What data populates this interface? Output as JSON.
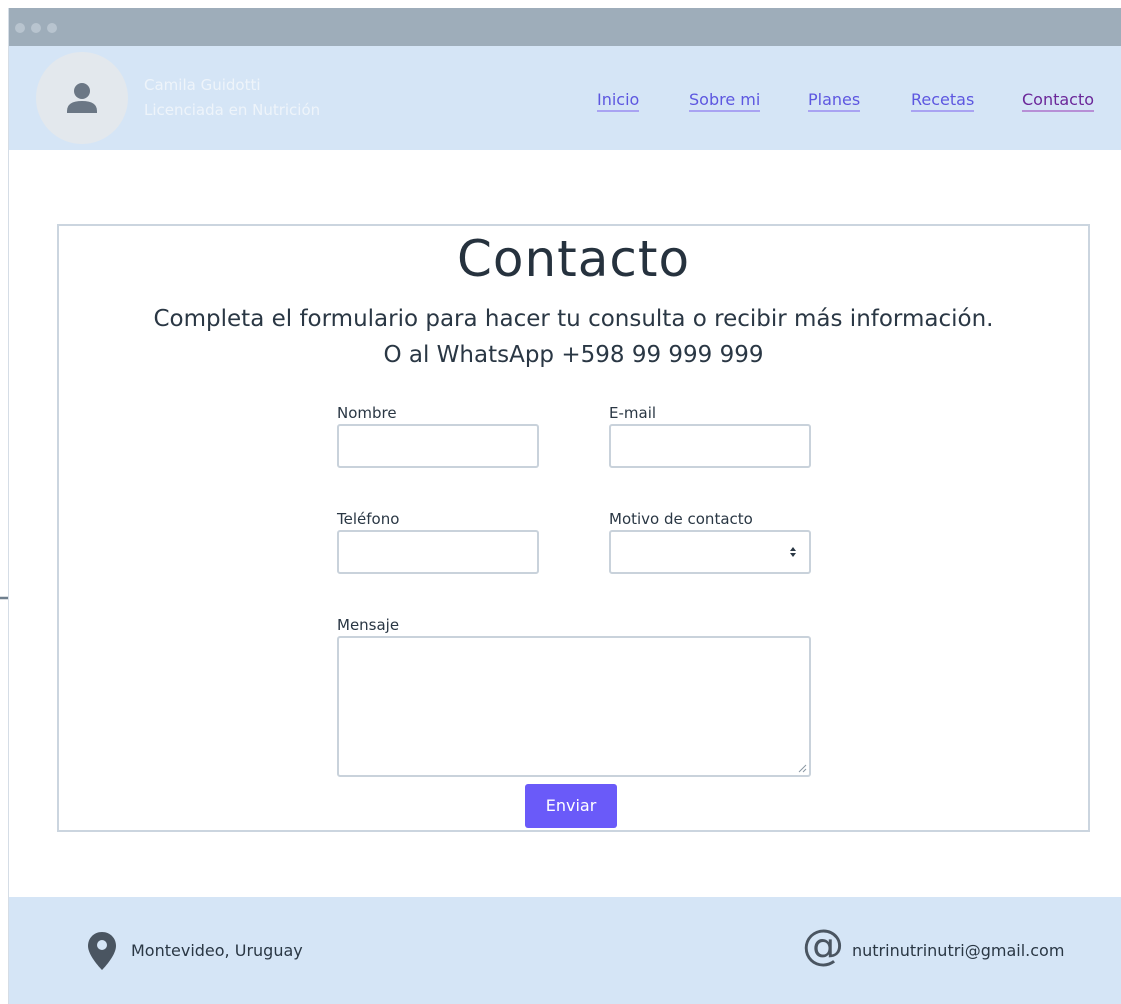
{
  "header": {
    "brand_name": "Camila Guidotti",
    "brand_title": "Licenciada en Nutrición",
    "nav": [
      {
        "label": "Inicio"
      },
      {
        "label": "Sobre mi"
      },
      {
        "label": "Planes"
      },
      {
        "label": "Recetas"
      },
      {
        "label": "Contacto",
        "active": true
      }
    ]
  },
  "contact": {
    "title": "Contacto",
    "subtitle": "Completa el formulario para hacer tu consulta o recibir más información.",
    "whatsapp": "O al WhatsApp +598 99 999 999",
    "fields": {
      "name_label": "Nombre",
      "email_label": "E-mail",
      "phone_label": "Teléfono",
      "reason_label": "Motivo de contacto",
      "message_label": "Mensaje"
    },
    "submit_label": "Enviar"
  },
  "footer": {
    "location": "Montevideo, Uruguay",
    "email": "nutrinutrinutri@gmail.com"
  },
  "colors": {
    "accent": "#6a5af9",
    "header_bg": "#d5e5f6",
    "nav_link": "#5d57e0",
    "nav_active": "#6b2799"
  },
  "icons": [
    "user-icon",
    "location-pin-icon",
    "at-icon",
    "arrow-right-icon",
    "select-arrows-icon",
    "resize-handle-icon"
  ]
}
